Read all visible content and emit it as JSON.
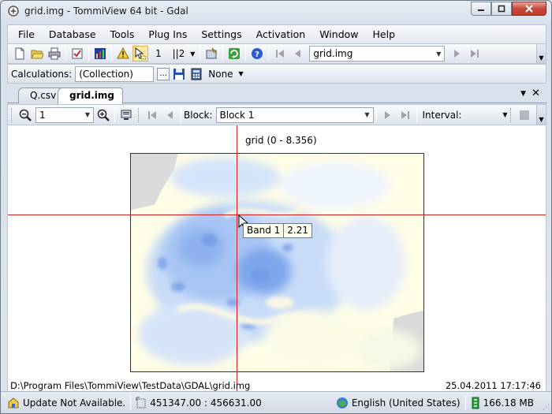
{
  "window": {
    "title": "grid.img - TommiView 64 bit - Gdal"
  },
  "menu": [
    "File",
    "Database",
    "Tools",
    "Plug Ins",
    "Settings",
    "Activation",
    "Window",
    "Help"
  ],
  "toolbar1": {
    "page_num": "1",
    "page_count": "||2",
    "file_combo": "grid.img"
  },
  "toolbar2": {
    "calc_label": "Calculations:",
    "calc_value": "(Collection)",
    "browse_label": "...",
    "none_label": "None"
  },
  "tabs": [
    {
      "label": "Q.csv",
      "active": false
    },
    {
      "label": "grid.img",
      "active": true
    }
  ],
  "view_toolbar": {
    "zoom_value": "1",
    "block_label": "Block:",
    "block_value": "Block 1",
    "interval_label": "Interval:"
  },
  "canvas": {
    "grid_title": "grid (0 - 8.356)",
    "tooltip_band": "Band 1",
    "tooltip_value": "2.21",
    "file_path": "D:\\Program Files\\TommiView\\TestData\\GDAL\\grid.img",
    "timestamp": "25.04.2011 17:17:46"
  },
  "status": {
    "update": "Update Not Available.",
    "coords": "451347.00 : 456631.00",
    "language": "English (United States)",
    "memory": "166.18 MB"
  },
  "colors": {
    "crosshair": "#d02020",
    "raster_low": "#fffde8",
    "raster_high": "#4a7ae0"
  }
}
